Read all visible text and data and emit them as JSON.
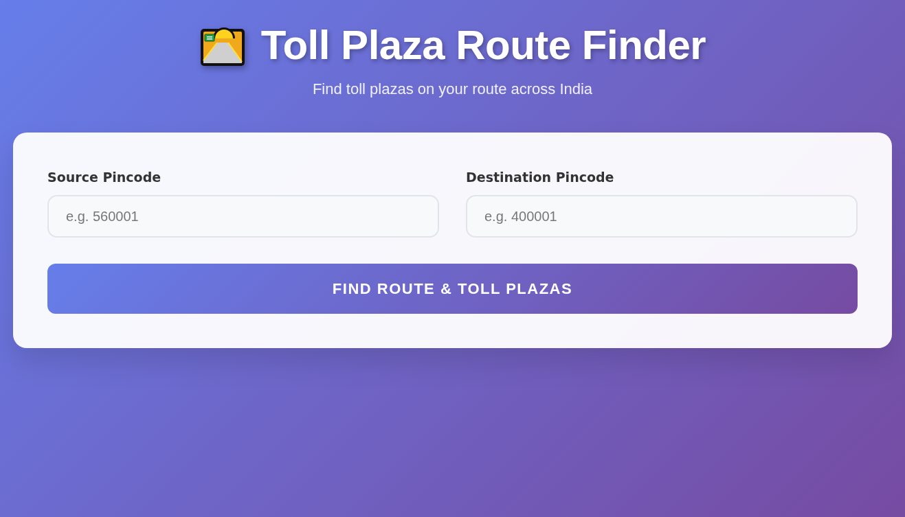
{
  "header": {
    "title": "Toll Plaza Route Finder",
    "subtitle": "Find toll plazas on your route across India"
  },
  "form": {
    "fields": [
      {
        "label": "Source Pincode",
        "placeholder": "e.g. 560001"
      },
      {
        "label": "Destination Pincode",
        "placeholder": "e.g. 400001"
      }
    ],
    "button": "FIND ROUTE & TOLL PLAZAS"
  }
}
